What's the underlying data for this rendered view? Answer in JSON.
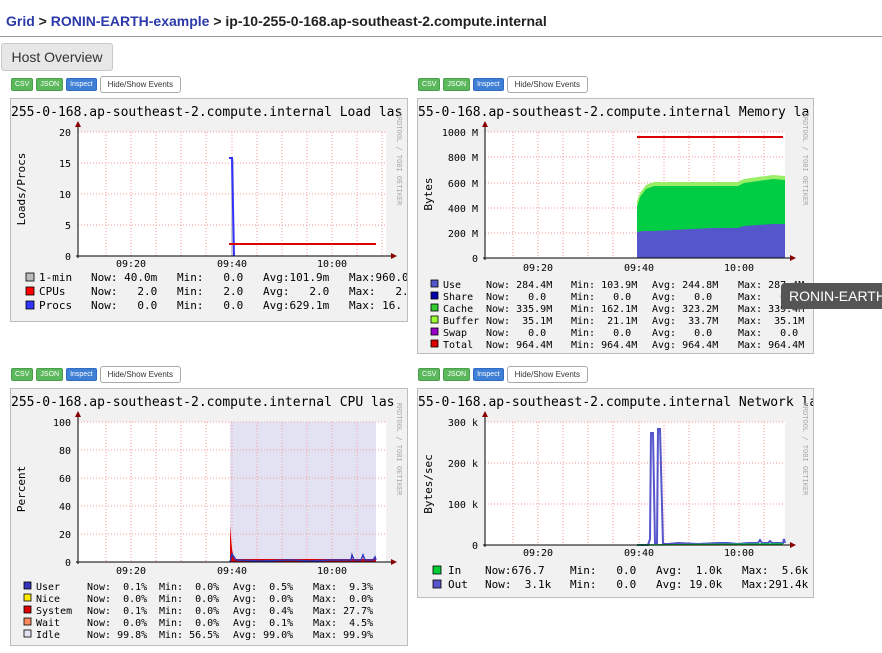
{
  "breadcrumb": {
    "grid": "Grid",
    "sep1": " > ",
    "cluster": "RONIN-EARTH-example",
    "sep2": " > ",
    "host": "ip-10-255-0-168.ap-southeast-2.compute.internal"
  },
  "host_overview_label": "Host Overview",
  "toolbar": {
    "csv": "CSV",
    "json": "JSON",
    "inspect": "Inspect",
    "events": "Hide/Show Events"
  },
  "watermark": "RRDTOOL / TOBI OETIKER",
  "tooltip": "RONIN-EARTH",
  "colors": {
    "red": "#dd0000",
    "blue": "#3333bb",
    "cache_green": "#00cc33",
    "buffer_green": "#66ee66",
    "grid_red": "#ff8888"
  },
  "x_ticks": [
    "09:20",
    "09:40",
    "10:00"
  ],
  "graphs": {
    "load": {
      "title": "255-0-168.ap-southeast-2.compute.internal Load las",
      "ylabel": "Loads/Procs",
      "yticks": [
        "20",
        "15",
        "10",
        "5",
        "0"
      ],
      "legend": [
        {
          "name": "1-min",
          "color": "#bbbbbb",
          "now": "Now: 40.0m",
          "min": "Min:   0.0",
          "avg": "Avg:101.9m",
          "max": "Max:960.0"
        },
        {
          "name": "CPUs",
          "color": "#ff0000",
          "now": "Now:   2.0",
          "min": "Min:   2.0",
          "avg": "Avg:   2.0",
          "max": "Max:   2."
        },
        {
          "name": "Procs",
          "color": "#3333ff",
          "now": "Now:   0.0",
          "min": "Min:   0.0",
          "avg": "Avg:629.1m",
          "max": "Max: 16."
        }
      ]
    },
    "memory": {
      "title": "55-0-168.ap-southeast-2.compute.internal Memory la",
      "ylabel": "Bytes",
      "yticks": [
        "1000 M",
        "800 M",
        "600 M",
        "400 M",
        "200 M",
        "0"
      ],
      "legend": [
        {
          "name": "Use",
          "color": "#5555cc",
          "now": "Now: 284.4M",
          "min": "Min: 103.9M",
          "avg": "Avg: 244.8M",
          "max": "Max: 287.4M"
        },
        {
          "name": "Share",
          "color": "#0000aa",
          "now": "Now:   0.0",
          "min": "Min:   0.0",
          "avg": "Avg:   0.0",
          "max": "Max:   0.0"
        },
        {
          "name": "Cache",
          "color": "#33cc33",
          "now": "Now: 335.9M",
          "min": "Min: 162.1M",
          "avg": "Avg: 323.2M",
          "max": "Max: 339.4M"
        },
        {
          "name": "Buffer",
          "color": "#99ff33",
          "now": "Now:  35.1M",
          "min": "Min:  21.1M",
          "avg": "Avg:  33.7M",
          "max": "Max:  35.1M"
        },
        {
          "name": "Swap",
          "color": "#9900cc",
          "now": "Now:   0.0",
          "min": "Min:   0.0",
          "avg": "Avg:   0.0",
          "max": "Max:   0.0"
        },
        {
          "name": "Total",
          "color": "#dd0000",
          "now": "Now: 964.4M",
          "min": "Min: 964.4M",
          "avg": "Avg: 964.4M",
          "max": "Max: 964.4M"
        }
      ]
    },
    "cpu": {
      "title": "255-0-168.ap-southeast-2.compute.internal CPU las",
      "ylabel": "Percent",
      "yticks": [
        "100",
        "80",
        "60",
        "40",
        "20",
        "0"
      ],
      "legend": [
        {
          "name": "User",
          "color": "#3333bb",
          "now": "Now:  0.1%",
          "min": "Min:  0.0%",
          "avg": "Avg:  0.5%",
          "max": "Max:  9.3%"
        },
        {
          "name": "Nice",
          "color": "#ffea00",
          "now": "Now:  0.0%",
          "min": "Min:  0.0%",
          "avg": "Avg:  0.0%",
          "max": "Max:  0.0%"
        },
        {
          "name": "System",
          "color": "#dd0000",
          "now": "Now:  0.1%",
          "min": "Min:  0.0%",
          "avg": "Avg:  0.4%",
          "max": "Max: 27.7%"
        },
        {
          "name": "Wait",
          "color": "#ff8a60",
          "now": "Now:  0.0%",
          "min": "Min:  0.0%",
          "avg": "Avg:  0.1%",
          "max": "Max:  4.5%"
        },
        {
          "name": "Idle",
          "color": "#e2e2f2",
          "now": "Now: 99.8%",
          "min": "Min: 56.5%",
          "avg": "Avg: 99.0%",
          "max": "Max: 99.9%"
        }
      ]
    },
    "network": {
      "title": "55-0-168.ap-southeast-2.compute.internal Network la",
      "ylabel": "Bytes/sec",
      "yticks": [
        "300 k",
        "200 k",
        "100 k",
        "0"
      ],
      "legend": [
        {
          "name": "In",
          "color": "#00cc33",
          "now": "Now:676.7",
          "min": "Min:   0.0",
          "avg": "Avg:  1.0k",
          "max": "Max:  5.6k"
        },
        {
          "name": "Out",
          "color": "#5555cc",
          "now": "Now:  3.1k",
          "min": "Min:   0.0",
          "avg": "Avg: 19.0k",
          "max": "Max:291.4k"
        }
      ]
    }
  }
}
